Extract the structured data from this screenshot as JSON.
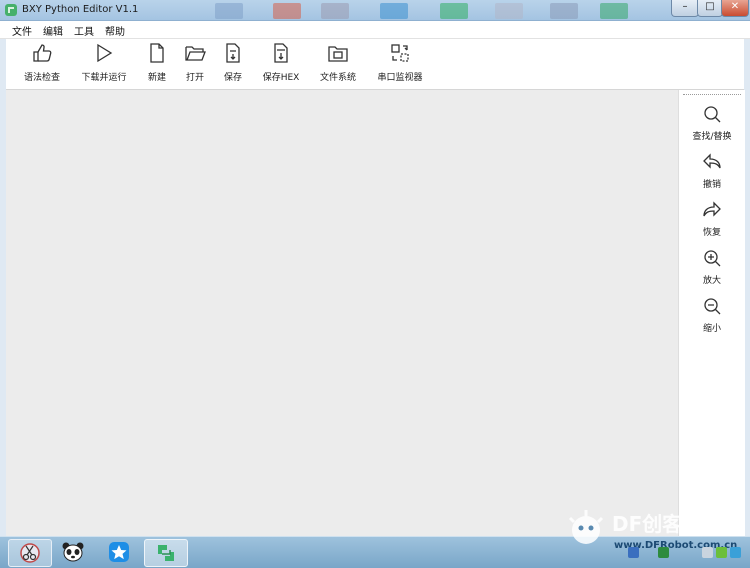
{
  "window": {
    "title": "BXY Python Editor V1.1",
    "min_glyph": "–",
    "max_glyph": "□",
    "close_glyph": "✕"
  },
  "menu": {
    "items": [
      "文件",
      "编辑",
      "工具",
      "帮助"
    ]
  },
  "toolbar": {
    "items": [
      {
        "label": "语法检查",
        "icon": "thumbs-up-icon"
      },
      {
        "label": "下载并运行",
        "icon": "play-icon"
      },
      {
        "label": "新建",
        "icon": "new-file-icon"
      },
      {
        "label": "打开",
        "icon": "open-folder-icon"
      },
      {
        "label": "保存",
        "icon": "save-py-icon"
      },
      {
        "label": "保存HEX",
        "icon": "save-hex-icon"
      },
      {
        "label": "文件系统",
        "icon": "file-system-icon"
      },
      {
        "label": "串口监视器",
        "icon": "serial-monitor-icon"
      }
    ]
  },
  "sidebar": {
    "items": [
      {
        "label": "查找/替换",
        "icon": "search-icon"
      },
      {
        "label": "撤销",
        "icon": "undo-icon"
      },
      {
        "label": "恢复",
        "icon": "redo-icon"
      },
      {
        "label": "放大",
        "icon": "zoom-in-icon"
      },
      {
        "label": "缩小",
        "icon": "zoom-out-icon"
      }
    ]
  },
  "watermark": {
    "text": "DF创客",
    "url": "www.DFRobot.com.cn"
  },
  "colors": {
    "editor_bg": "#ececec",
    "taskbar": "#8db6d6",
    "titlebar": "#b0cbe6",
    "close": "#c94b30"
  }
}
